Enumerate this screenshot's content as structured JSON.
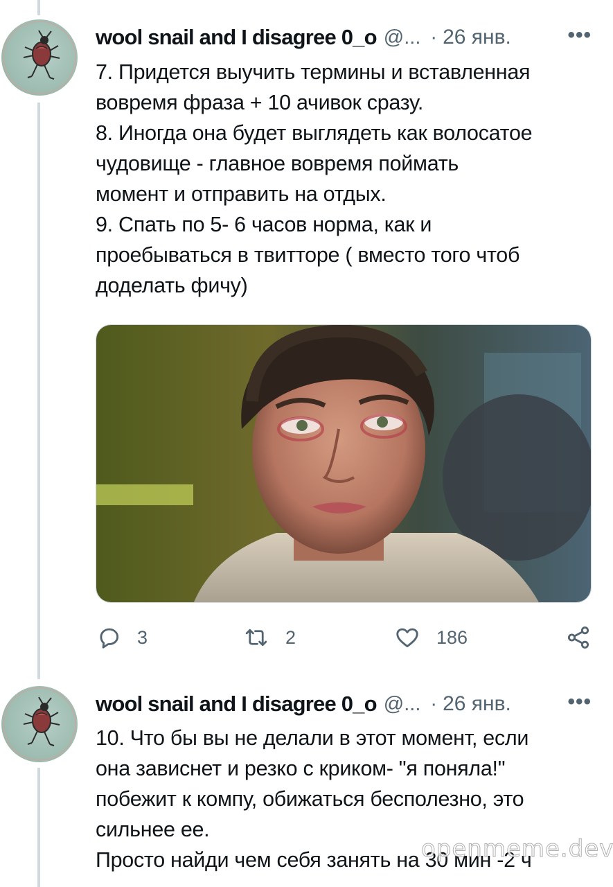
{
  "tweets": [
    {
      "display_name": "wool snail and I disagree 0_o",
      "handle": "@...",
      "separator": "·",
      "date": "26 янв.",
      "more": "•••",
      "lines": [
        "7. Придется выучить термины и вставленная",
        "вовремя фраза + 10 ачивок сразу.",
        "8. Иногда она будет выглядеть как волосатое",
        "чудовище - главное вовремя поймать",
        "момент и отправить на отдых.",
        "9. Спать по 5- 6 часов норма, как и",
        "проебываться в твитторе ( вместо того чтоб",
        "доделать фичу)"
      ],
      "actions": {
        "reply": {
          "icon": "reply-icon",
          "count": "3"
        },
        "retweet": {
          "icon": "retweet-icon",
          "count": "2"
        },
        "like": {
          "icon": "heart-icon",
          "count": "186"
        },
        "share": {
          "icon": "share-icon"
        }
      }
    },
    {
      "display_name": "wool snail and I disagree 0_o",
      "handle": "@...",
      "separator": "·",
      "date": "26 янв.",
      "more": "•••",
      "lines": [
        "10. Что бы вы не делали в этот момент, если",
        "она зависнет и резко с криком- \"я поняла!\"",
        "побежит к компу, обижаться бесполезно, это",
        "сильнее ее.",
        "Просто найди чем себя занять на 30 мин -2 ч"
      ]
    }
  ],
  "watermark": "openmeme.dev",
  "colors": {
    "text": "#0f1419",
    "secondary": "#536471",
    "thread_line": "#cfd9de"
  }
}
